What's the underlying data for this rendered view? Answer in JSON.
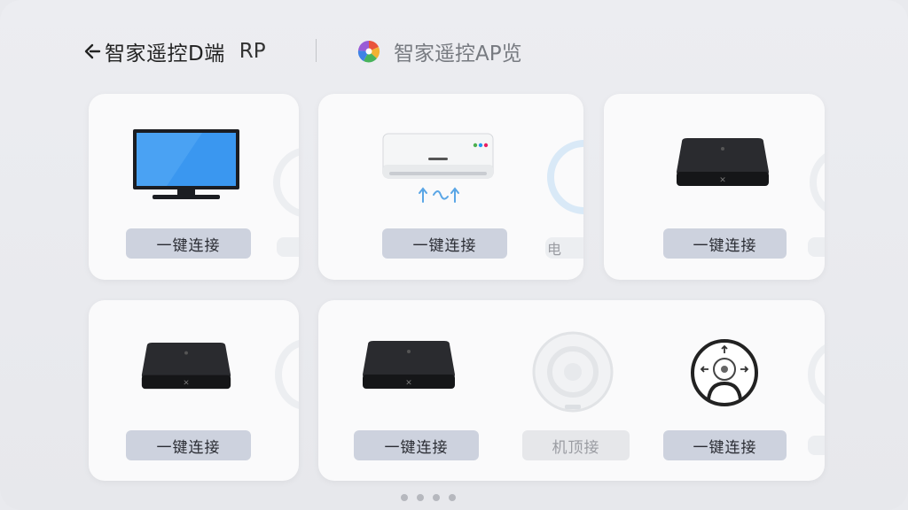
{
  "header": {
    "title": "智家遥控D端",
    "title_suffix": "RP",
    "app_tab_label": "智家遥控AP览"
  },
  "cards": [
    {
      "device": "tv-icon",
      "button_label": "一键连接"
    },
    {
      "device": "air-conditioner-icon",
      "button_label": "一键连接",
      "peek_label": "电"
    },
    {
      "device": "set-top-box-icon",
      "button_label": "一键连接"
    },
    {
      "device": "set-top-box-icon",
      "button_label": "一键连接"
    },
    {
      "devices": [
        "set-top-box-icon",
        "round-remote-icon",
        "joystick-remote-icon"
      ],
      "button_labels": [
        "一键连接",
        "机顶接",
        "一键连接"
      ]
    }
  ],
  "pager": {
    "count": 4,
    "active_index": 3
  },
  "colors": {
    "button_bg": "#cdd2de",
    "tv_screen": "#2f8ef0",
    "accent_blue": "#5aa6e6"
  }
}
